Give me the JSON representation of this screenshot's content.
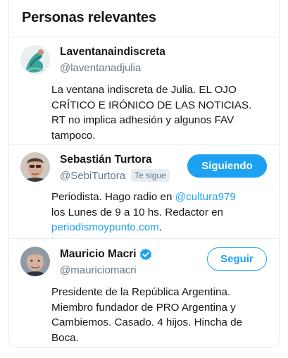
{
  "header": {
    "title": "Personas relevantes"
  },
  "people": [
    {
      "name": "Laventanaindiscreta",
      "handle": "@laventanadjulia",
      "bio": "La ventana indiscreta de Julia. EL OJO\nCRÍTICO E IRÓNICO DE LAS NOTICIAS.\nRT no implica adhesión y algunos FAV\ntampoco."
    },
    {
      "name": "Sebastián Turtora",
      "handle": "@SebiTurtora",
      "follows_you_badge": "Te sigue",
      "button_label": "Siguiendo",
      "bio_part1": "Periodista. Hago radio en ",
      "bio_link1": "@cultura979",
      "bio_part2": "\nlos Lunes de 9 a 10 hs. Redactor en\n",
      "bio_link2": "periodismoypunto.com",
      "bio_part3": "."
    },
    {
      "name": "Mauricio Macri",
      "handle": "@mauriciomacri",
      "verified": true,
      "button_label": "Seguir",
      "bio": "Presidente de la República Argentina.\nMiembro fundador de PRO Argentina y\nCambiemos. Casado. 4 hijos. Hincha de\nBoca."
    }
  ],
  "colors": {
    "accent": "#1da1f2",
    "text": "#14171a",
    "secondary": "#657786",
    "border": "#e6ecf0"
  }
}
